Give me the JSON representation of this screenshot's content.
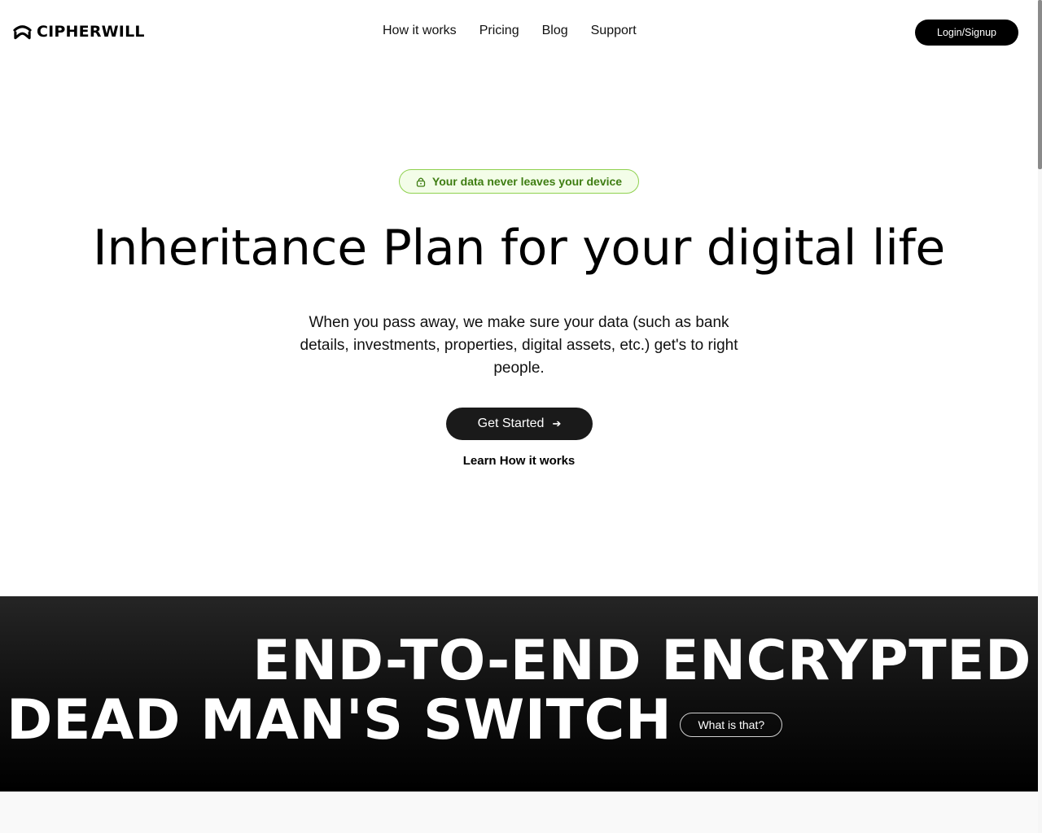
{
  "header": {
    "brand": "CIPHERWILL",
    "nav": [
      {
        "label": "How it works"
      },
      {
        "label": "Pricing"
      },
      {
        "label": "Blog"
      },
      {
        "label": "Support"
      }
    ],
    "login_label": "Login/Signup"
  },
  "hero": {
    "badge": {
      "icon": "lock-icon",
      "text": "Your data never leaves your device",
      "color": "#3e7d12",
      "border": "#8fd14f",
      "background": "#f3fde8"
    },
    "title": "Inheritance Plan for your digital life",
    "subtitle": "When you pass away, we make sure your data (such as bank details, investments, properties, digital assets, etc.) get's to right people.",
    "cta_label": "Get Started",
    "cta_icon": "arrow-right-icon",
    "learn_label": "Learn How it works"
  },
  "banner": {
    "line1": "END-TO-END ENCRYPTED",
    "line2": "DEAD MAN'S SWITCH",
    "what_label": "What is that?"
  },
  "scroll": {
    "position_fraction": 0.0
  }
}
